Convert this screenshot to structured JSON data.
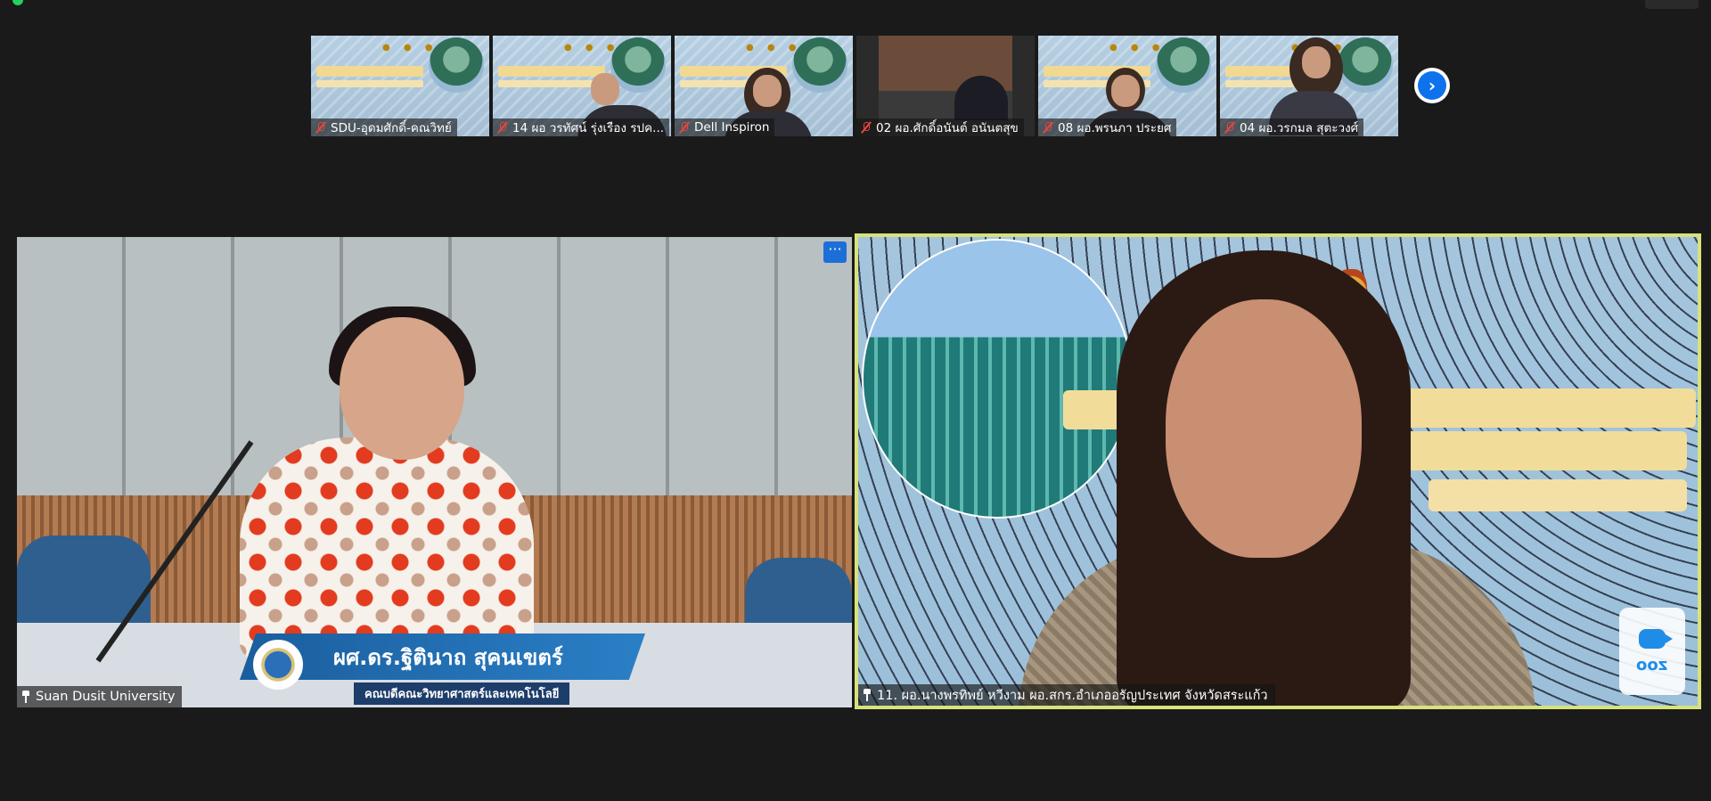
{
  "thumbnails": [
    {
      "name": "SDU-อุดมศักดิ์-คณวิทย์",
      "muted": true
    },
    {
      "name": "14 ผอ วรทัศน์ รุ่งเรือง รปค...",
      "muted": true
    },
    {
      "name": "Dell Inspiron",
      "muted": true
    },
    {
      "name": "02 ผอ.ศักดิ์อนันต์ อนันตสุข",
      "muted": true
    },
    {
      "name": "08 ผอ.พรนภา  ประยศ",
      "muted": true
    },
    {
      "name": "04 ผอ.วรกมล สุตะวงศ์",
      "muted": true
    }
  ],
  "main_left": {
    "participant": "Suan Dusit University",
    "overlay_name": "ผศ.ดร.ฐิตินาถ  สุคนเขตร์",
    "overlay_title": "คณบดีคณะวิทยาศาสตร์และเทคโนโลยี",
    "more_label": "···"
  },
  "main_right": {
    "participant": "11. ผอ.นางพรทิพย์ หวีงาม ผอ.สกร.อำเภออรัญประเทศ จังหวัดสระแก้ว",
    "zoom_badge": "zoo"
  },
  "colors": {
    "background": "#1a1a1a",
    "active_speaker_border": "#d8e27a",
    "accent": "#0e72ed",
    "muted_icon": "#e8453c"
  },
  "icons": {
    "next_page": "chevron-right-icon",
    "muted": "mic-muted-icon",
    "pinned": "pin-icon"
  }
}
